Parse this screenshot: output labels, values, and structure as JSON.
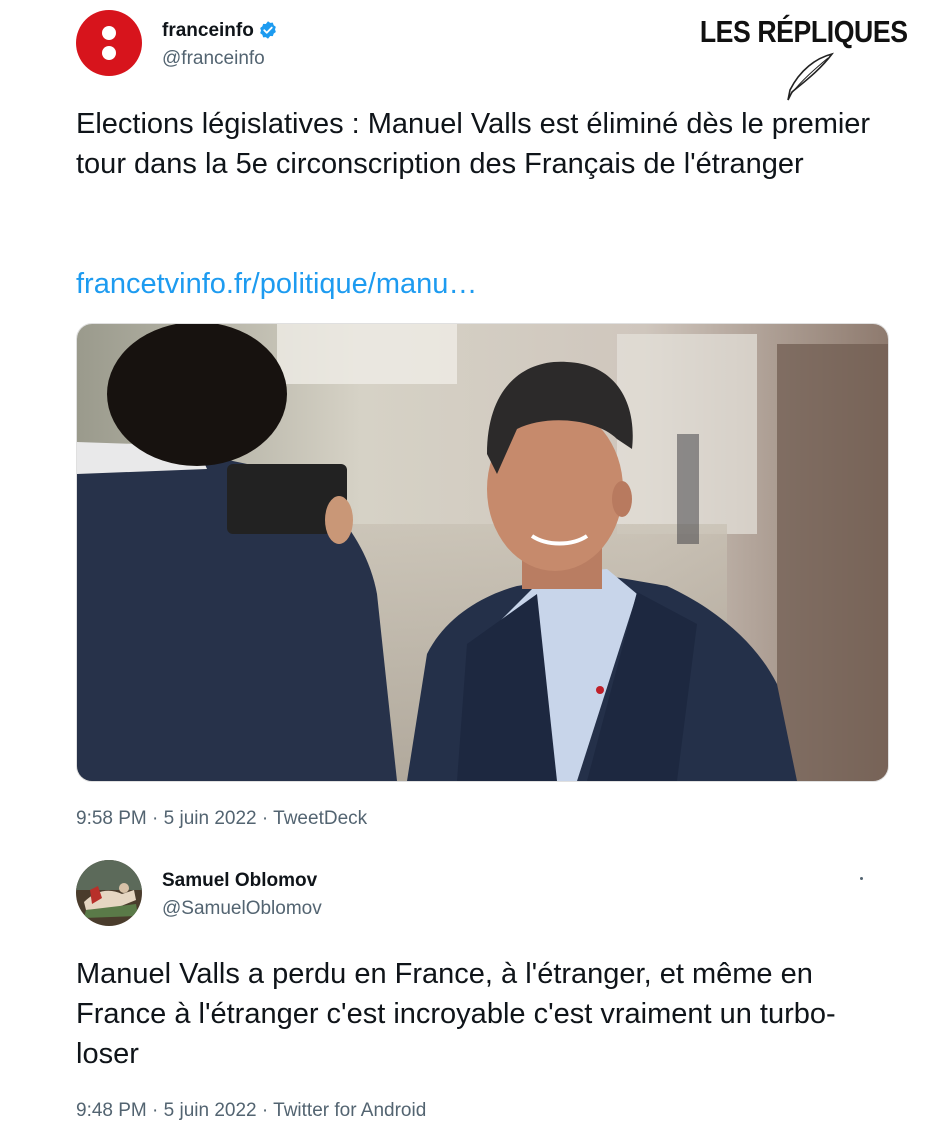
{
  "watermark": {
    "brand": "LES RÉPLIQUES"
  },
  "tweet1": {
    "author": {
      "name": "franceinfo",
      "handle": "@franceinfo",
      "verified": true
    },
    "text": "Elections législatives : Manuel Valls est éliminé dès le premier tour dans la 5e circonscription des Français de l'étranger",
    "link": "francetvinfo.fr/politique/manu…",
    "media": {
      "description_icon": "photo"
    },
    "meta": "9:58 PM · 5 juin 2022 · TweetDeck"
  },
  "tweet2": {
    "author": {
      "name": "Samuel Oblomov",
      "handle": "@SamuelOblomov"
    },
    "text": "Manuel Valls a perdu en France, à l'étranger, et même en France à l'étranger c'est incroyable c'est vraiment un turbo-loser",
    "meta": "9:48 PM · 5 juin 2022 · Twitter for Android"
  },
  "colors": {
    "link": "#1d9bf0",
    "verified": "#1d9bf0",
    "brand_red": "#d7141c"
  }
}
